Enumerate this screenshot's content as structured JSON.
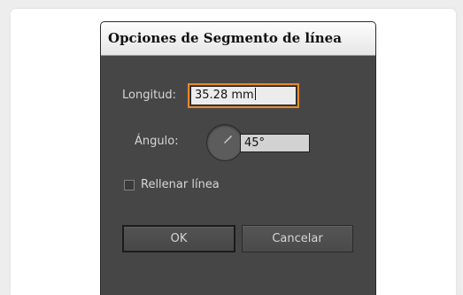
{
  "dialog": {
    "title": "Opciones de Segmento de línea",
    "length": {
      "label": "Longitud:",
      "value": "35.28 mm"
    },
    "angle": {
      "label": "Ángulo:",
      "value": "45°",
      "dial_degrees": 45
    },
    "fill_line": {
      "label": "Rellenar línea",
      "checked": false
    },
    "buttons": {
      "ok": "OK",
      "cancel": "Cancelar"
    }
  },
  "colors": {
    "dialog_bg": "#464646",
    "focus_ring": "#e48a2c",
    "field_bg": "#d2d2d2"
  }
}
